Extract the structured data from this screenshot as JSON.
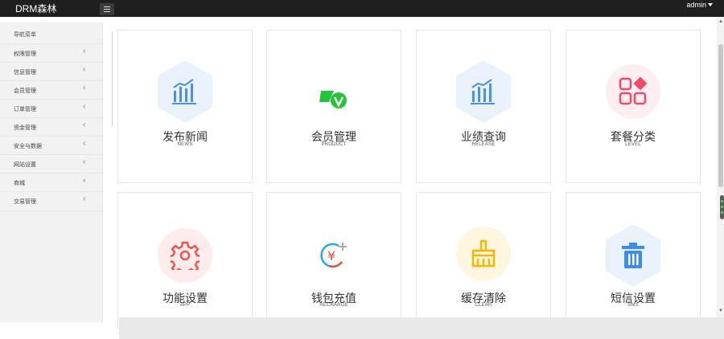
{
  "app": {
    "brand": "DRM森林",
    "user": "admin"
  },
  "sidebar": {
    "title": "导航菜单",
    "items": [
      {
        "label": "权限管理"
      },
      {
        "label": "信息管理"
      },
      {
        "label": "会员管理"
      },
      {
        "label": "订单管理"
      },
      {
        "label": "资金管理"
      },
      {
        "label": "安全与数据"
      },
      {
        "label": "网站设置"
      },
      {
        "label": "商城"
      },
      {
        "label": "交易管理"
      }
    ]
  },
  "cards": [
    {
      "title": "发布新闻",
      "subtitle": "NEWS",
      "icon": "bar-chart-icon",
      "color": "#4c8fe8",
      "bg": "#e9f2fc"
    },
    {
      "title": "会员管理",
      "subtitle": "PRODUCT",
      "icon": "money-check-icon",
      "color": "#23c33a",
      "bg": "#ffffff"
    },
    {
      "title": "业绩查询",
      "subtitle": "RELEASE",
      "icon": "bar-chart-icon",
      "color": "#4c8fe8",
      "bg": "#e9f2fc"
    },
    {
      "title": "套餐分类",
      "subtitle": "LEVEL",
      "icon": "category-grid-icon",
      "color": "#f04a6b",
      "bg": "#fdeef1"
    },
    {
      "title": "功能设置",
      "subtitle": "APP",
      "icon": "gear-icon",
      "color": "#ef5350",
      "bg": "#fdecec"
    },
    {
      "title": "钱包充值",
      "subtitle": "RECHARGE",
      "icon": "yen-recharge-icon",
      "color": "#f2513c",
      "bg": "#ffffff"
    },
    {
      "title": "缓存清除",
      "subtitle": "CLEAR",
      "icon": "broom-icon",
      "color": "#f5b800",
      "bg": "#fff6df"
    },
    {
      "title": "短信设置",
      "subtitle": "SMS",
      "icon": "trash-icon",
      "color": "#3f8be8",
      "bg": "#e9f2fc"
    }
  ]
}
